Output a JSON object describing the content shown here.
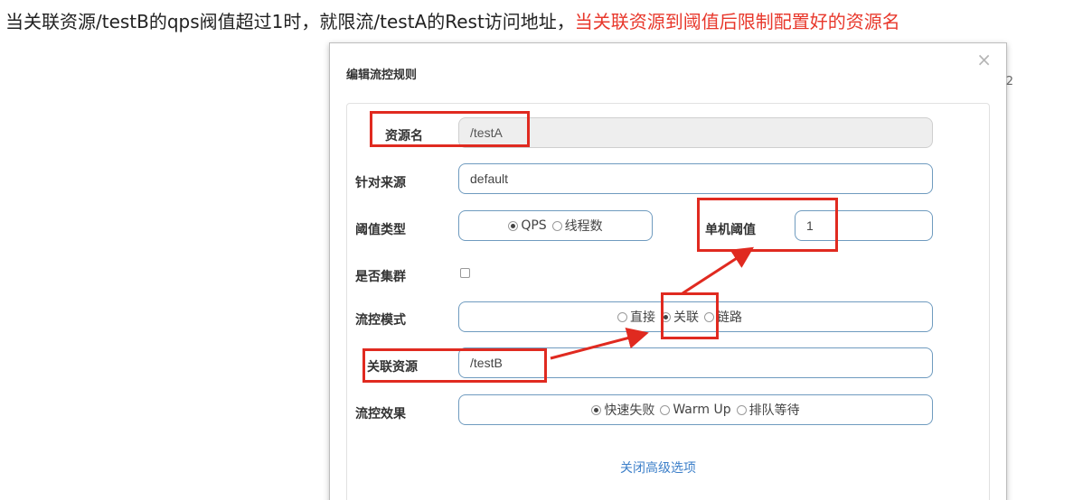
{
  "caption": {
    "text": "当关联资源/testB的qps阀值超过1时，就限流/testA的Rest访问地址，",
    "highlight": "当关联资源到阈值后限制配置好的资源名"
  },
  "dialog": {
    "title": "编辑流控规则",
    "close": "×",
    "edge_glyph": "2"
  },
  "form": {
    "resource": {
      "label": "资源名",
      "value": "/testA"
    },
    "origin": {
      "label": "针对来源",
      "value": "default"
    },
    "threshold_type": {
      "label": "阈值类型",
      "options": [
        "QPS",
        "线程数"
      ],
      "selected": "QPS"
    },
    "single_threshold": {
      "label": "单机阈值",
      "value": "1"
    },
    "cluster": {
      "label": "是否集群",
      "checked": false
    },
    "control_mode": {
      "label": "流控模式",
      "options": [
        "直接",
        "关联",
        "链路"
      ],
      "selected": "关联"
    },
    "related_resource": {
      "label": "关联资源",
      "value": "/testB"
    },
    "control_effect": {
      "label": "流控效果",
      "options": [
        "快速失败",
        "Warm Up",
        "排队等待"
      ],
      "selected": "快速失败"
    },
    "advanced_link": "关闭高级选项"
  },
  "colors": {
    "annotation": "#e02a20",
    "field_border": "#6f9bbf",
    "link": "#3c7fc9"
  }
}
